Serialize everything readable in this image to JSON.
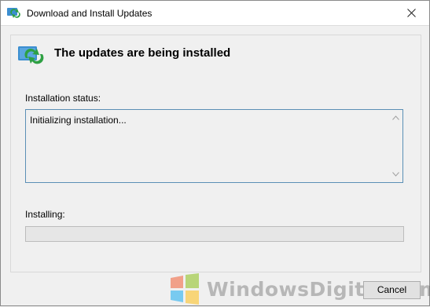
{
  "window": {
    "title": "Download and Install Updates",
    "icon": "windows-update-icon",
    "close_icon": "close-icon"
  },
  "header": {
    "title": "The updates are being installed",
    "icon": "windows-update-icon"
  },
  "status": {
    "label": "Installation status:",
    "text": "Initializing installation..."
  },
  "installing": {
    "label": "Installing:",
    "progress_fraction": 0
  },
  "buttons": {
    "cancel": "Cancel"
  },
  "watermark": {
    "text": "WindowsDigital.com",
    "logo": "windows-flag-logo"
  },
  "colors": {
    "accent_border": "#5b8fb5",
    "progress_green": "#06b025",
    "update_green": "#2ea043",
    "update_blue": "#3b8ed0"
  }
}
